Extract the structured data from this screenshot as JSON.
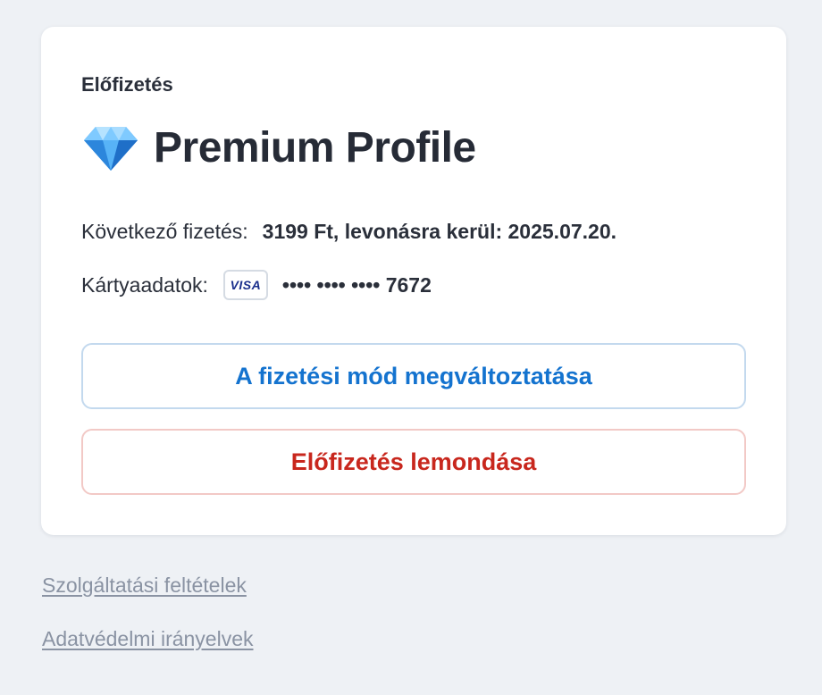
{
  "subscription": {
    "section_label": "Előfizetés",
    "plan_icon": "diamond-icon",
    "plan_name": "Premium Profile",
    "payment_label": "Következő fizetés:",
    "payment_value": "3199 Ft, levonásra kerül: 2025.07.20.",
    "card_label": "Kártyaadatok:",
    "card_brand": "VISA",
    "card_number": "•••• •••• •••• 7672"
  },
  "actions": {
    "change_payment_label": "A fizetési mód megváltoztatása",
    "cancel_label": "Előfizetés lemondása"
  },
  "footer": {
    "terms_label": "Szolgáltatási feltételek",
    "privacy_label": "Adatvédelmi irányelvek"
  },
  "colors": {
    "background": "#eef1f5",
    "primary_blue": "#1473cf",
    "danger_red": "#c8271d",
    "link_gray": "#8a93a3"
  }
}
